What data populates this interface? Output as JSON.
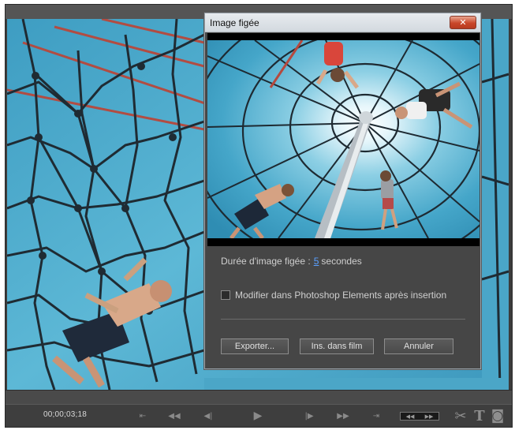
{
  "dialog": {
    "title": "Image figée",
    "close_glyph": "✕",
    "duration_label": "Durée d'image figée :",
    "duration_value": "5",
    "duration_unit": "secondes",
    "checkbox_label": "Modifier dans Photoshop Elements après insertion",
    "checkbox_checked": false,
    "buttons": {
      "export": "Exporter...",
      "insert": "Ins. dans film",
      "cancel": "Annuler"
    }
  },
  "transport": {
    "timecode": "00;00;03;18",
    "controls": [
      {
        "name": "go-to-start-icon",
        "glyph": "⇤"
      },
      {
        "name": "rewind-icon",
        "glyph": "◀◀"
      },
      {
        "name": "step-back-icon",
        "glyph": "◀|"
      },
      {
        "name": "play-icon",
        "glyph": "▶"
      },
      {
        "name": "step-forward-icon",
        "glyph": "|▶"
      },
      {
        "name": "fast-forward-icon",
        "glyph": "▶▶"
      },
      {
        "name": "go-to-end-icon",
        "glyph": "⇥"
      }
    ],
    "scrub_glyph_left": "◀◀",
    "scrub_glyph_right": "▶▶",
    "tools": [
      {
        "name": "scissors-icon",
        "glyph": "✂"
      },
      {
        "name": "text-tool-icon",
        "glyph": "T"
      },
      {
        "name": "camera-icon",
        "glyph": "◙"
      }
    ]
  },
  "colors": {
    "sky": "#48aacb",
    "sky_light": "#dff3fa",
    "rope": "#1d2a33",
    "rope_red": "#b54a3f",
    "accent_link": "#5aa0ff",
    "close_red": "#c9472a"
  }
}
